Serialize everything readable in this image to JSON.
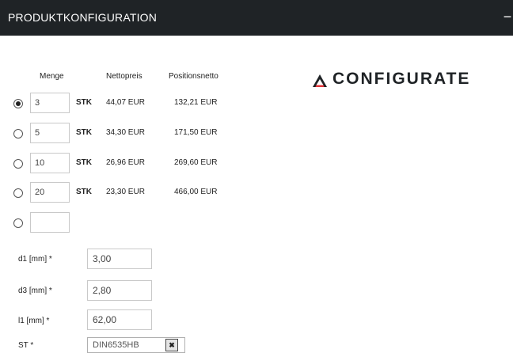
{
  "header": {
    "title": "PRODUKTKONFIGURATION",
    "collapse_label": "−"
  },
  "price_table": {
    "columns": {
      "quantity": "Menge",
      "net_price": "Nettopreis",
      "position_net": "Positionsnetto"
    },
    "rows": [
      {
        "quantity": "3",
        "unit": "STK",
        "net_price": "44,07 EUR",
        "position_net": "132,21 EUR",
        "selected": true
      },
      {
        "quantity": "5",
        "unit": "STK",
        "net_price": "34,30 EUR",
        "position_net": "171,50 EUR",
        "selected": false
      },
      {
        "quantity": "10",
        "unit": "STK",
        "net_price": "26,96 EUR",
        "position_net": "269,60 EUR",
        "selected": false
      },
      {
        "quantity": "20",
        "unit": "STK",
        "net_price": "23,30 EUR",
        "position_net": "466,00 EUR",
        "selected": false
      }
    ],
    "custom_row": {
      "quantity": "",
      "selected": false
    }
  },
  "parameters": [
    {
      "label": "d1 [mm] *",
      "value": "3,00"
    },
    {
      "label": "d3 [mm] *",
      "value": "2,80"
    },
    {
      "label": "l1 [mm] *",
      "value": "62,00"
    }
  ],
  "st_field": {
    "label": "ST *",
    "selected_value": "DIN6535HB"
  },
  "logo": {
    "icon": "triangle-logo-icon",
    "text": "CONFIGURATE",
    "colors": {
      "dark": "#1f2326",
      "accent": "#e0353a"
    }
  },
  "colors": {
    "header_bg": "#1f2326",
    "header_text": "#ffffff",
    "input_border": "#c9c9c9"
  }
}
